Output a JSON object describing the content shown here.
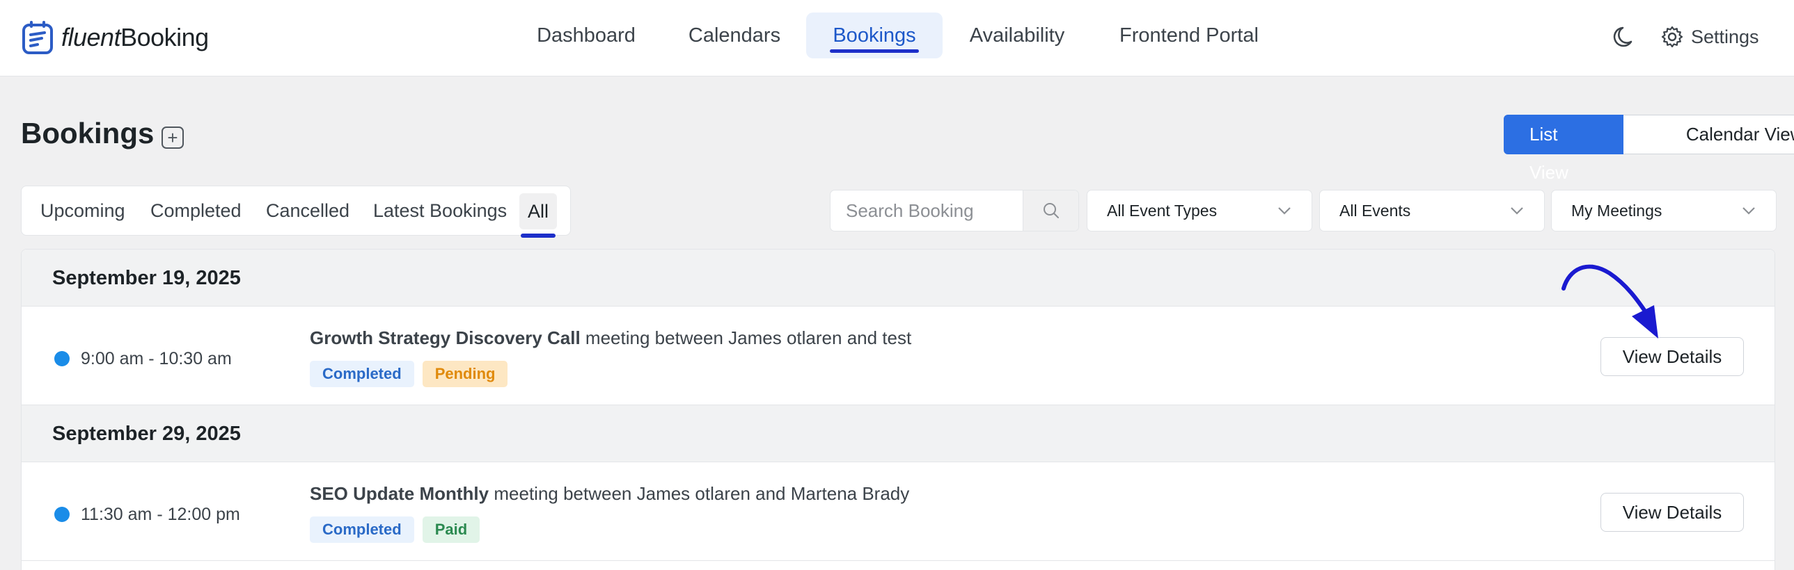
{
  "brand": {
    "name_light": "fluent",
    "name_bold": "Booking"
  },
  "nav": {
    "items": [
      {
        "label": "Dashboard"
      },
      {
        "label": "Calendars"
      },
      {
        "label": "Bookings",
        "active": true
      },
      {
        "label": "Availability"
      },
      {
        "label": "Frontend Portal"
      }
    ],
    "settings_label": "Settings",
    "icons": [
      "moon-icon",
      "gear-icon"
    ]
  },
  "page": {
    "title": "Bookings",
    "add_button": "+",
    "views": {
      "list": "List View",
      "calendar": "Calendar View",
      "selected": "List View"
    }
  },
  "tabs": [
    {
      "label": "Upcoming"
    },
    {
      "label": "Completed"
    },
    {
      "label": "Cancelled"
    },
    {
      "label": "Latest Bookings"
    },
    {
      "label": "All",
      "active": true
    }
  ],
  "filters": {
    "search_placeholder": "Search Booking",
    "event_types": "All Event Types",
    "events": "All Events",
    "meetings": "My Meetings"
  },
  "groups": [
    {
      "date": "September 19, 2025",
      "bookings": [
        {
          "time": "9:00 am - 10:30 am",
          "event": "Growth Strategy Discovery Call",
          "desc": "meeting between James otlaren and test",
          "badges": [
            {
              "label": "Completed",
              "kind": "completed"
            },
            {
              "label": "Pending",
              "kind": "pending"
            }
          ],
          "action": "View Details"
        }
      ]
    },
    {
      "date": "September 29, 2025",
      "bookings": [
        {
          "time": "11:30 am - 12:00 pm",
          "event": "SEO Update Monthly",
          "desc": "meeting between James otlaren and Martena Brady",
          "badges": [
            {
              "label": "Completed",
              "kind": "completed"
            },
            {
              "label": "Paid",
              "kind": "paid"
            }
          ],
          "action": "View Details"
        }
      ]
    }
  ],
  "colors": {
    "accent": "#2c6fe3",
    "underline": "#1d2fc9",
    "status_dot": "#1a8ce8",
    "annotation_arrow": "#1a1ad0"
  }
}
